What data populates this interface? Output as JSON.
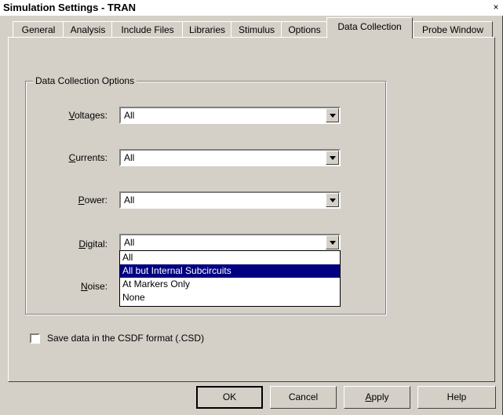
{
  "window": {
    "title": "Simulation Settings - TRAN",
    "close_glyph": "×"
  },
  "tabs": [
    {
      "label": "General"
    },
    {
      "label": "Analysis"
    },
    {
      "label": "Include Files"
    },
    {
      "label": "Libraries"
    },
    {
      "label": "Stimulus"
    },
    {
      "label": "Options"
    },
    {
      "label": "Data Collection",
      "active": true
    },
    {
      "label": "Probe Window"
    }
  ],
  "group": {
    "title": "Data Collection Options",
    "fields": [
      {
        "label_acc": "V",
        "label_rest": "oltages:",
        "value": "All"
      },
      {
        "label_acc": "C",
        "label_rest": "urrents:",
        "value": "All"
      },
      {
        "label_acc": "P",
        "label_rest": "ower:",
        "value": "All"
      },
      {
        "label_acc": "D",
        "label_rest": "igital:",
        "value": "All"
      },
      {
        "label_acc": "N",
        "label_rest": "oise:",
        "value": ""
      }
    ],
    "dropdown_options": [
      "All",
      "All but Internal Subcircuits",
      "At Markers Only",
      "None"
    ],
    "dropdown_highlighted": "All but Internal Subcircuits"
  },
  "checkbox": {
    "label": "Save data in the CSDF format (.CSD)",
    "checked": false
  },
  "buttons": {
    "ok": "OK",
    "cancel": "Cancel",
    "apply_acc": "A",
    "apply_rest": "pply",
    "help": "Help"
  },
  "colors": {
    "face": "#d4d0c8",
    "highlight": "#000080"
  }
}
